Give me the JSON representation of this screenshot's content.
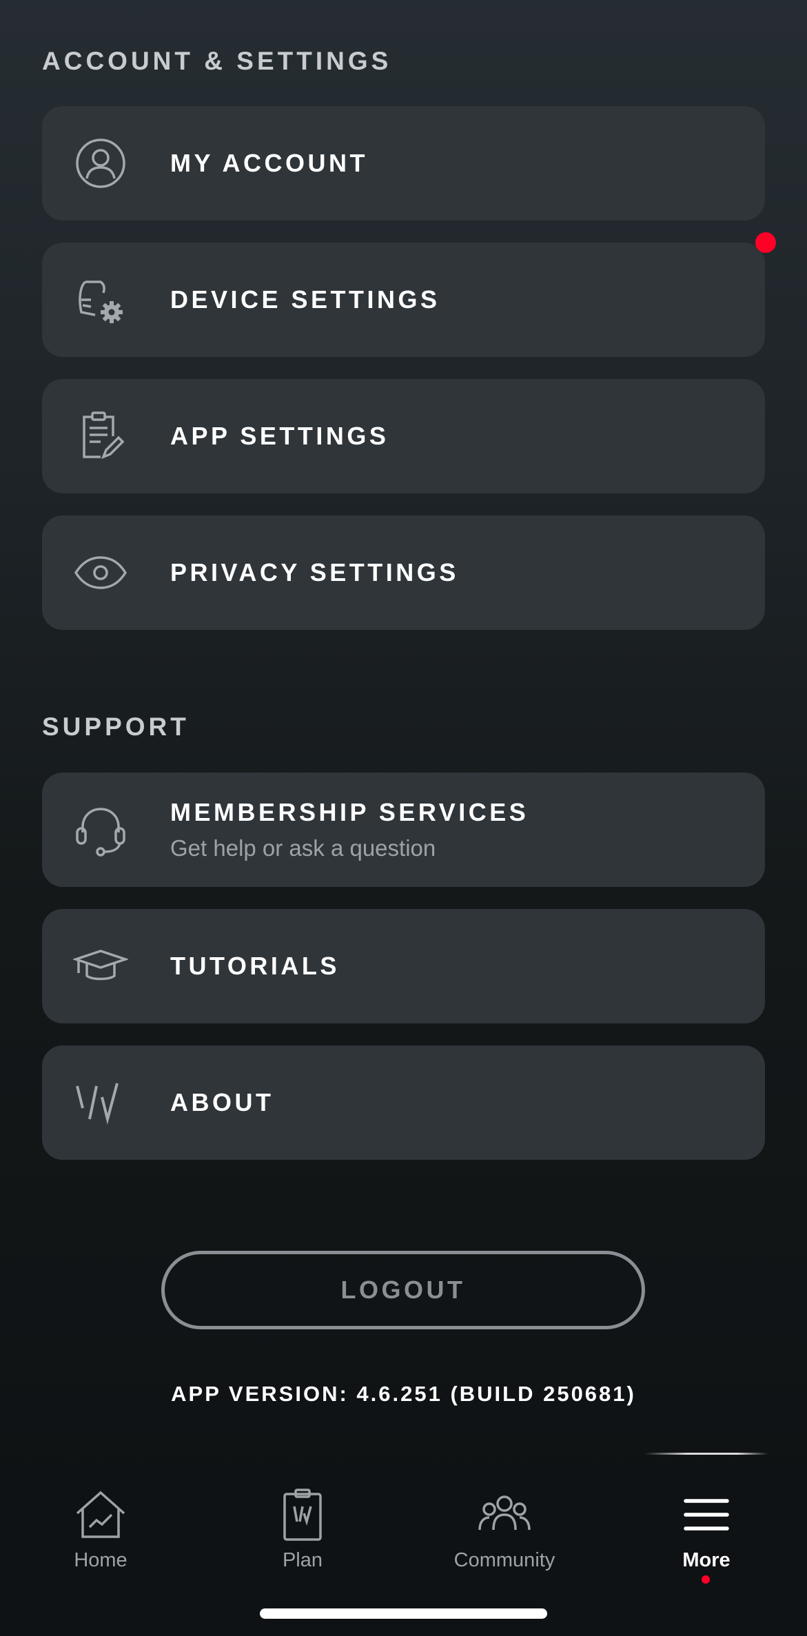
{
  "sections": {
    "account_header": "ACCOUNT & SETTINGS",
    "support_header": "SUPPORT"
  },
  "account_items": [
    {
      "label": "MY ACCOUNT",
      "icon": "person-icon"
    },
    {
      "label": "DEVICE SETTINGS",
      "icon": "device-gear-icon",
      "notification": true
    },
    {
      "label": "APP SETTINGS",
      "icon": "clipboard-edit-icon"
    },
    {
      "label": "PRIVACY SETTINGS",
      "icon": "eye-icon"
    }
  ],
  "support_items": [
    {
      "label": "MEMBERSHIP SERVICES",
      "sublabel": "Get help or ask a question",
      "icon": "headset-icon"
    },
    {
      "label": "TUTORIALS",
      "icon": "graduation-cap-icon"
    },
    {
      "label": "ABOUT",
      "icon": "whoop-logo-icon"
    }
  ],
  "logout_label": "LOGOUT",
  "app_version": "APP VERSION: 4.6.251 (BUILD 250681)",
  "tabs": [
    {
      "label": "Home",
      "icon": "home-chart-icon",
      "active": false
    },
    {
      "label": "Plan",
      "icon": "plan-clipboard-icon",
      "active": false
    },
    {
      "label": "Community",
      "icon": "community-people-icon",
      "active": false
    },
    {
      "label": "More",
      "icon": "menu-icon",
      "active": true,
      "notification": true
    }
  ],
  "colors": {
    "notification": "#ff0026",
    "card": "#2f3539",
    "muted_text": "#9ea3a7"
  }
}
